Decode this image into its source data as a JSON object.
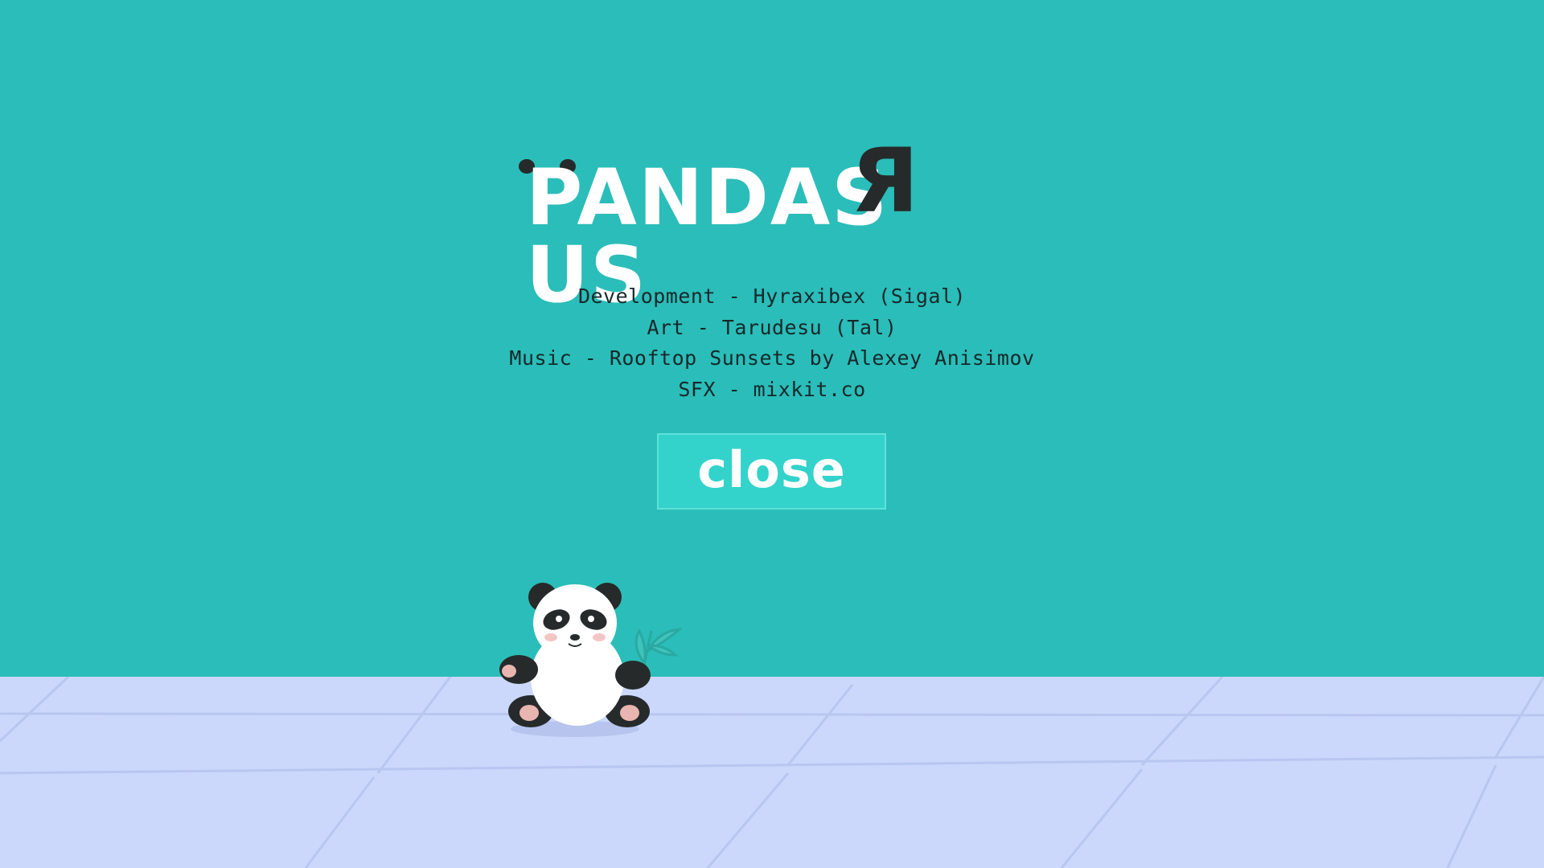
{
  "logo": {
    "text": "PANDAS",
    "reversed_letter": "Я",
    "suffix": "US"
  },
  "credits": [
    "Development - Hyraxibex (Sigal)",
    "Art - Tarudesu (Tal)",
    "Music - Rooftop Sunsets by Alexey Anisimov",
    "SFX - mixkit.co"
  ],
  "close_button": {
    "label": "close"
  },
  "colors": {
    "wall": "#2bbdb9",
    "floor": "#cbd8fb",
    "button": "#33d3cc",
    "text": "#15282a"
  },
  "icons": [
    "panda-icon",
    "bamboo-icon"
  ]
}
